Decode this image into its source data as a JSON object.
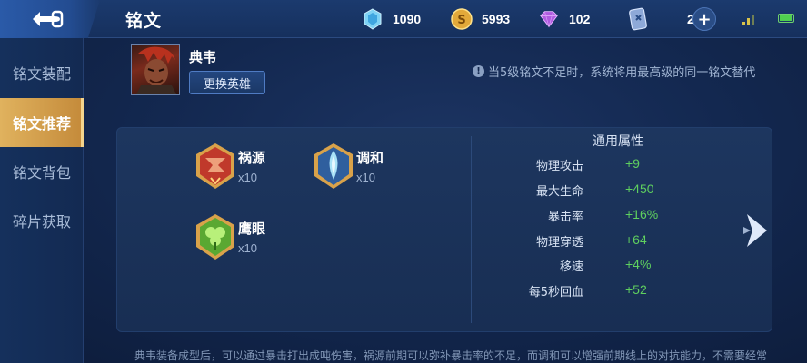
{
  "header": {
    "title": "铭文",
    "currencies": {
      "diamond": "1090",
      "coin": "5993",
      "gem": "102",
      "card": "2"
    }
  },
  "sidebar": {
    "items": [
      {
        "label": "铭文装配",
        "active": false
      },
      {
        "label": "铭文推荐",
        "active": true
      },
      {
        "label": "铭文背包",
        "active": false
      },
      {
        "label": "碎片获取",
        "active": false
      }
    ]
  },
  "hero": {
    "name": "典韦",
    "change_button": "更换英雄"
  },
  "tip": "当5级铭文不足时，系统将用最高级的同一铭文替代",
  "runes": [
    {
      "name": "祸源",
      "count": "x10",
      "color": "#c0392b"
    },
    {
      "name": "调和",
      "count": "x10",
      "color": "#3a78c9"
    },
    {
      "name": "鹰眼",
      "count": "x10",
      "color": "#5aa832"
    }
  ],
  "attributes": {
    "title": "通用属性",
    "rows": [
      {
        "name": "物理攻击",
        "value": "+9"
      },
      {
        "name": "最大生命",
        "value": "+450"
      },
      {
        "name": "暴击率",
        "value": "+16%"
      },
      {
        "name": "物理穿透",
        "value": "+64"
      },
      {
        "name": "移速",
        "value": "+4%"
      },
      {
        "name": "每5秒回血",
        "value": "+52"
      }
    ]
  },
  "footer": "典韦装备成型后，可以通过暴击打出成吨伤害，祸源前期可以弥补暴击率的不足，而调和可以增强前期线上的对抗能力，不需要经常",
  "colors": {
    "accent_gold": "#d9a24a",
    "value_green": "#5fd05f"
  }
}
